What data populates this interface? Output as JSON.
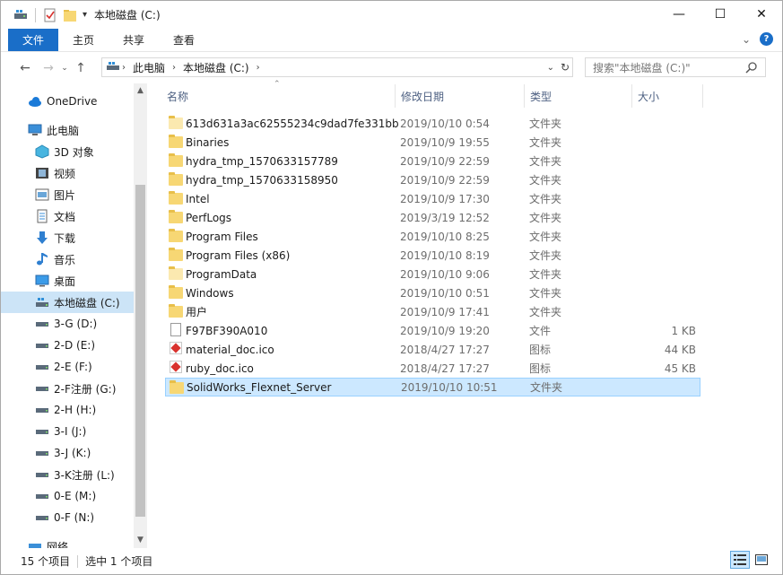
{
  "title_bar": {
    "path_title": "本地磁盘 (C:)",
    "controls": {
      "minimize": "—",
      "maximize": "☐",
      "close": "✕"
    }
  },
  "ribbon": {
    "tabs": [
      "文件",
      "主页",
      "共享",
      "查看"
    ],
    "collapse": "⌄",
    "help": "?"
  },
  "navigation": {
    "back": "←",
    "forward": "→",
    "recent": "⌄",
    "up": "↑",
    "breadcrumb": [
      "此电脑",
      "本地磁盘 (C:)"
    ],
    "search_placeholder": "搜索\"本地磁盘 (C:)\""
  },
  "nav_pane": {
    "items": [
      {
        "label": "OneDrive",
        "icon": "cloud-icon",
        "indent": 0
      },
      {
        "label": "此电脑",
        "icon": "computer-icon",
        "indent": 0
      },
      {
        "label": "3D 对象",
        "icon": "3d-objects-icon",
        "indent": 1
      },
      {
        "label": "视频",
        "icon": "video-icon",
        "indent": 1
      },
      {
        "label": "图片",
        "icon": "pictures-icon",
        "indent": 1
      },
      {
        "label": "文档",
        "icon": "documents-icon",
        "indent": 1
      },
      {
        "label": "下载",
        "icon": "download-icon",
        "indent": 1
      },
      {
        "label": "音乐",
        "icon": "music-icon",
        "indent": 1
      },
      {
        "label": "桌面",
        "icon": "desktop-icon",
        "indent": 1
      },
      {
        "label": "本地磁盘 (C:)",
        "icon": "system-drive-icon",
        "indent": 1,
        "selected": true
      },
      {
        "label": "3-G (D:)",
        "icon": "drive-icon",
        "indent": 1
      },
      {
        "label": "2-D (E:)",
        "icon": "drive-icon",
        "indent": 1
      },
      {
        "label": "2-E (F:)",
        "icon": "drive-icon",
        "indent": 1
      },
      {
        "label": "2-F注册 (G:)",
        "icon": "drive-icon",
        "indent": 1
      },
      {
        "label": "2-H (H:)",
        "icon": "drive-icon",
        "indent": 1
      },
      {
        "label": "3-I (J:)",
        "icon": "drive-icon",
        "indent": 1
      },
      {
        "label": "3-J (K:)",
        "icon": "drive-icon",
        "indent": 1
      },
      {
        "label": "3-K注册 (L:)",
        "icon": "drive-icon",
        "indent": 1
      },
      {
        "label": "0-E (M:)",
        "icon": "drive-icon",
        "indent": 1
      },
      {
        "label": "0-F (N:)",
        "icon": "drive-icon",
        "indent": 1
      },
      {
        "label": "网络",
        "icon": "network-icon",
        "indent": 0
      }
    ]
  },
  "file_list": {
    "columns": {
      "name": "名称",
      "date": "修改日期",
      "type": "类型",
      "size": "大小"
    },
    "sort_indicator": "⌃",
    "rows": [
      {
        "name": "613d631a3ac62555234c9dad7fe331bb",
        "date": "2019/10/10 0:54",
        "type": "文件夹",
        "size": "",
        "icon": "folder-light"
      },
      {
        "name": "Binaries",
        "date": "2019/10/9 19:55",
        "type": "文件夹",
        "size": "",
        "icon": "folder"
      },
      {
        "name": "hydra_tmp_1570633157789",
        "date": "2019/10/9 22:59",
        "type": "文件夹",
        "size": "",
        "icon": "folder"
      },
      {
        "name": "hydra_tmp_1570633158950",
        "date": "2019/10/9 22:59",
        "type": "文件夹",
        "size": "",
        "icon": "folder"
      },
      {
        "name": "Intel",
        "date": "2019/10/9 17:30",
        "type": "文件夹",
        "size": "",
        "icon": "folder"
      },
      {
        "name": "PerfLogs",
        "date": "2019/3/19 12:52",
        "type": "文件夹",
        "size": "",
        "icon": "folder"
      },
      {
        "name": "Program Files",
        "date": "2019/10/10 8:25",
        "type": "文件夹",
        "size": "",
        "icon": "folder"
      },
      {
        "name": "Program Files (x86)",
        "date": "2019/10/10 8:19",
        "type": "文件夹",
        "size": "",
        "icon": "folder"
      },
      {
        "name": "ProgramData",
        "date": "2019/10/10 9:06",
        "type": "文件夹",
        "size": "",
        "icon": "folder-light"
      },
      {
        "name": "Windows",
        "date": "2019/10/10 0:51",
        "type": "文件夹",
        "size": "",
        "icon": "folder"
      },
      {
        "name": "用户",
        "date": "2019/10/9 17:41",
        "type": "文件夹",
        "size": "",
        "icon": "folder"
      },
      {
        "name": "F97BF390A010",
        "date": "2019/10/9 19:20",
        "type": "文件",
        "size": "1 KB",
        "icon": "file"
      },
      {
        "name": "material_doc.ico",
        "date": "2018/4/27 17:27",
        "type": "图标",
        "size": "44 KB",
        "icon": "ico"
      },
      {
        "name": "ruby_doc.ico",
        "date": "2018/4/27 17:27",
        "type": "图标",
        "size": "45 KB",
        "icon": "ico"
      },
      {
        "name": "SolidWorks_Flexnet_Server",
        "date": "2019/10/10 10:51",
        "type": "文件夹",
        "size": "",
        "icon": "folder",
        "selected": true
      }
    ]
  },
  "status_bar": {
    "item_count": "15 个项目",
    "selection": "选中 1 个项目"
  },
  "colors": {
    "accent": "#1a6ec8",
    "selection": "#cce8ff",
    "folder": "#f7d774"
  }
}
